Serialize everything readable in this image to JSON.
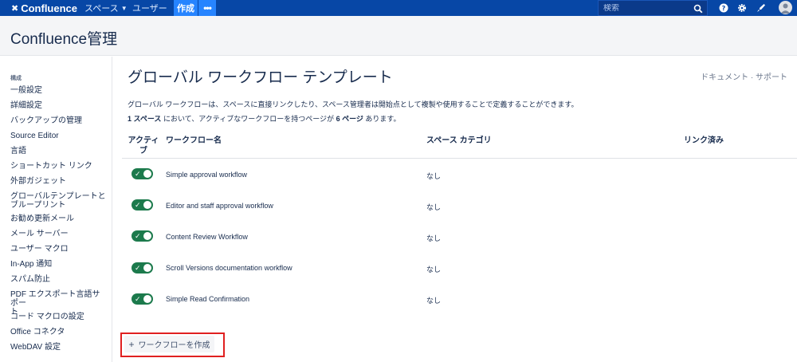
{
  "topnav": {
    "logo": "Confluence",
    "spaces": "スペース",
    "users": "ユーザー",
    "create": "作成",
    "more": "•••",
    "search_placeholder": "検索",
    "icons": [
      "help-icon",
      "gear-icon",
      "notification-icon"
    ]
  },
  "header": {
    "title": "Confluence管理"
  },
  "sidebar": {
    "heading": "構成",
    "items": [
      "一般設定",
      "詳細設定",
      "バックアップの管理",
      "Source Editor",
      "言語",
      "ショートカット リンク",
      "外部ガジェット",
      "グローバルテンプレートと\nブループリント",
      "お勧め更新メール",
      "メール サーバー",
      "ユーザー マクロ",
      "In-App 通知",
      "スパム防止",
      "PDF エクスポート言語サポー\nト",
      "コード マクロの設定",
      "Office コネクタ",
      "WebDAV 設定"
    ]
  },
  "main": {
    "title": "グローバル ワークフロー テンプレート",
    "doc_links": "ドキュメント · サポート",
    "description": "グローバル ワークフローは、スペースに直接リンクしたり、スペース管理者は開始点として複製や使用することで定義することができます。",
    "summary": {
      "count_spaces": "1 スペース",
      "text1": " において、アクティブなワークフローを持つページが ",
      "count_pages": "6 ページ",
      "text2": " あります。"
    },
    "table": {
      "headers": {
        "active": "アクティ\nブ",
        "name": "ワークフロー名",
        "category": "スペース カテゴリ",
        "linked": "リンク済み"
      },
      "rows": [
        {
          "active": true,
          "name": "Simple approval workflow",
          "category": "なし"
        },
        {
          "active": true,
          "name": "Editor and staff approval workflow",
          "category": "なし"
        },
        {
          "active": true,
          "name": "Content Review Workflow",
          "category": "なし"
        },
        {
          "active": true,
          "name": "Scroll Versions documentation workflow",
          "category": "なし"
        },
        {
          "active": true,
          "name": "Simple Read Confirmation",
          "category": "なし"
        }
      ]
    },
    "create_button": {
      "plus": "+",
      "label": "ワークフローを作成"
    }
  },
  "colors": {
    "nav": "#0747a6",
    "accent": "#2684ff",
    "toggle": "#1c7a4c",
    "highlight": "#e02020"
  }
}
